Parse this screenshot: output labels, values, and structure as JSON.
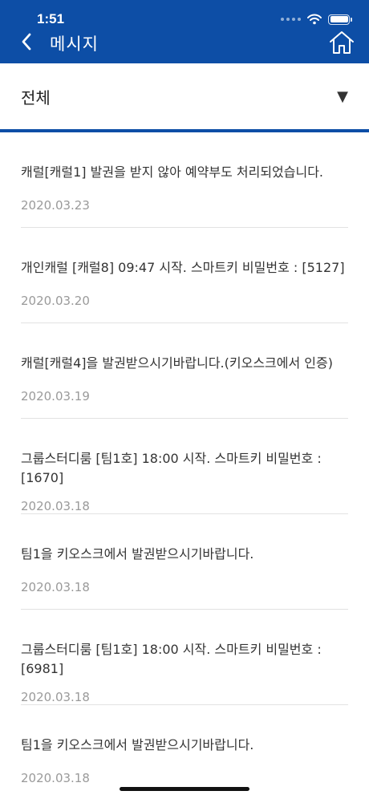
{
  "status": {
    "time": "1:51"
  },
  "header": {
    "title": "메시지"
  },
  "filter": {
    "label": "전체",
    "arrow": "▼"
  },
  "messages": [
    {
      "text": "캐럴[캐럴1] 발권을 받지 않아 예약부도 처리되었습니다.",
      "date": "2020.03.23"
    },
    {
      "text": "개인캐럴 [캐럴8] 09:47 시작.  스마트키 비밀번호 : [5127]",
      "date": "2020.03.20"
    },
    {
      "text": "캐럴[캐럴4]을 발권받으시기바랍니다.(키오스크에서 인증)",
      "date": "2020.03.19"
    },
    {
      "text": "그룹스터디룸 [팀1호] 18:00 시작.  스마트키 비밀번호 : [1670]",
      "date": "2020.03.18"
    },
    {
      "text": "팀1을 키오스크에서 발권받으시기바랍니다.",
      "date": "2020.03.18"
    },
    {
      "text": "그룹스터디룸 [팀1호] 18:00 시작.  스마트키 비밀번호 : [6981]",
      "date": "2020.03.18"
    },
    {
      "text": "팀1을 키오스크에서 발권받으시기바랍니다.",
      "date": "2020.03.18"
    }
  ],
  "colors": {
    "header_bg": "#0d4ea6",
    "date_text": "#9a9a9a",
    "divider": "#e2e2e2"
  },
  "icons": {
    "back": "chevron-left-icon",
    "home": "home-icon",
    "wifi": "wifi-icon",
    "battery": "battery-icon"
  }
}
